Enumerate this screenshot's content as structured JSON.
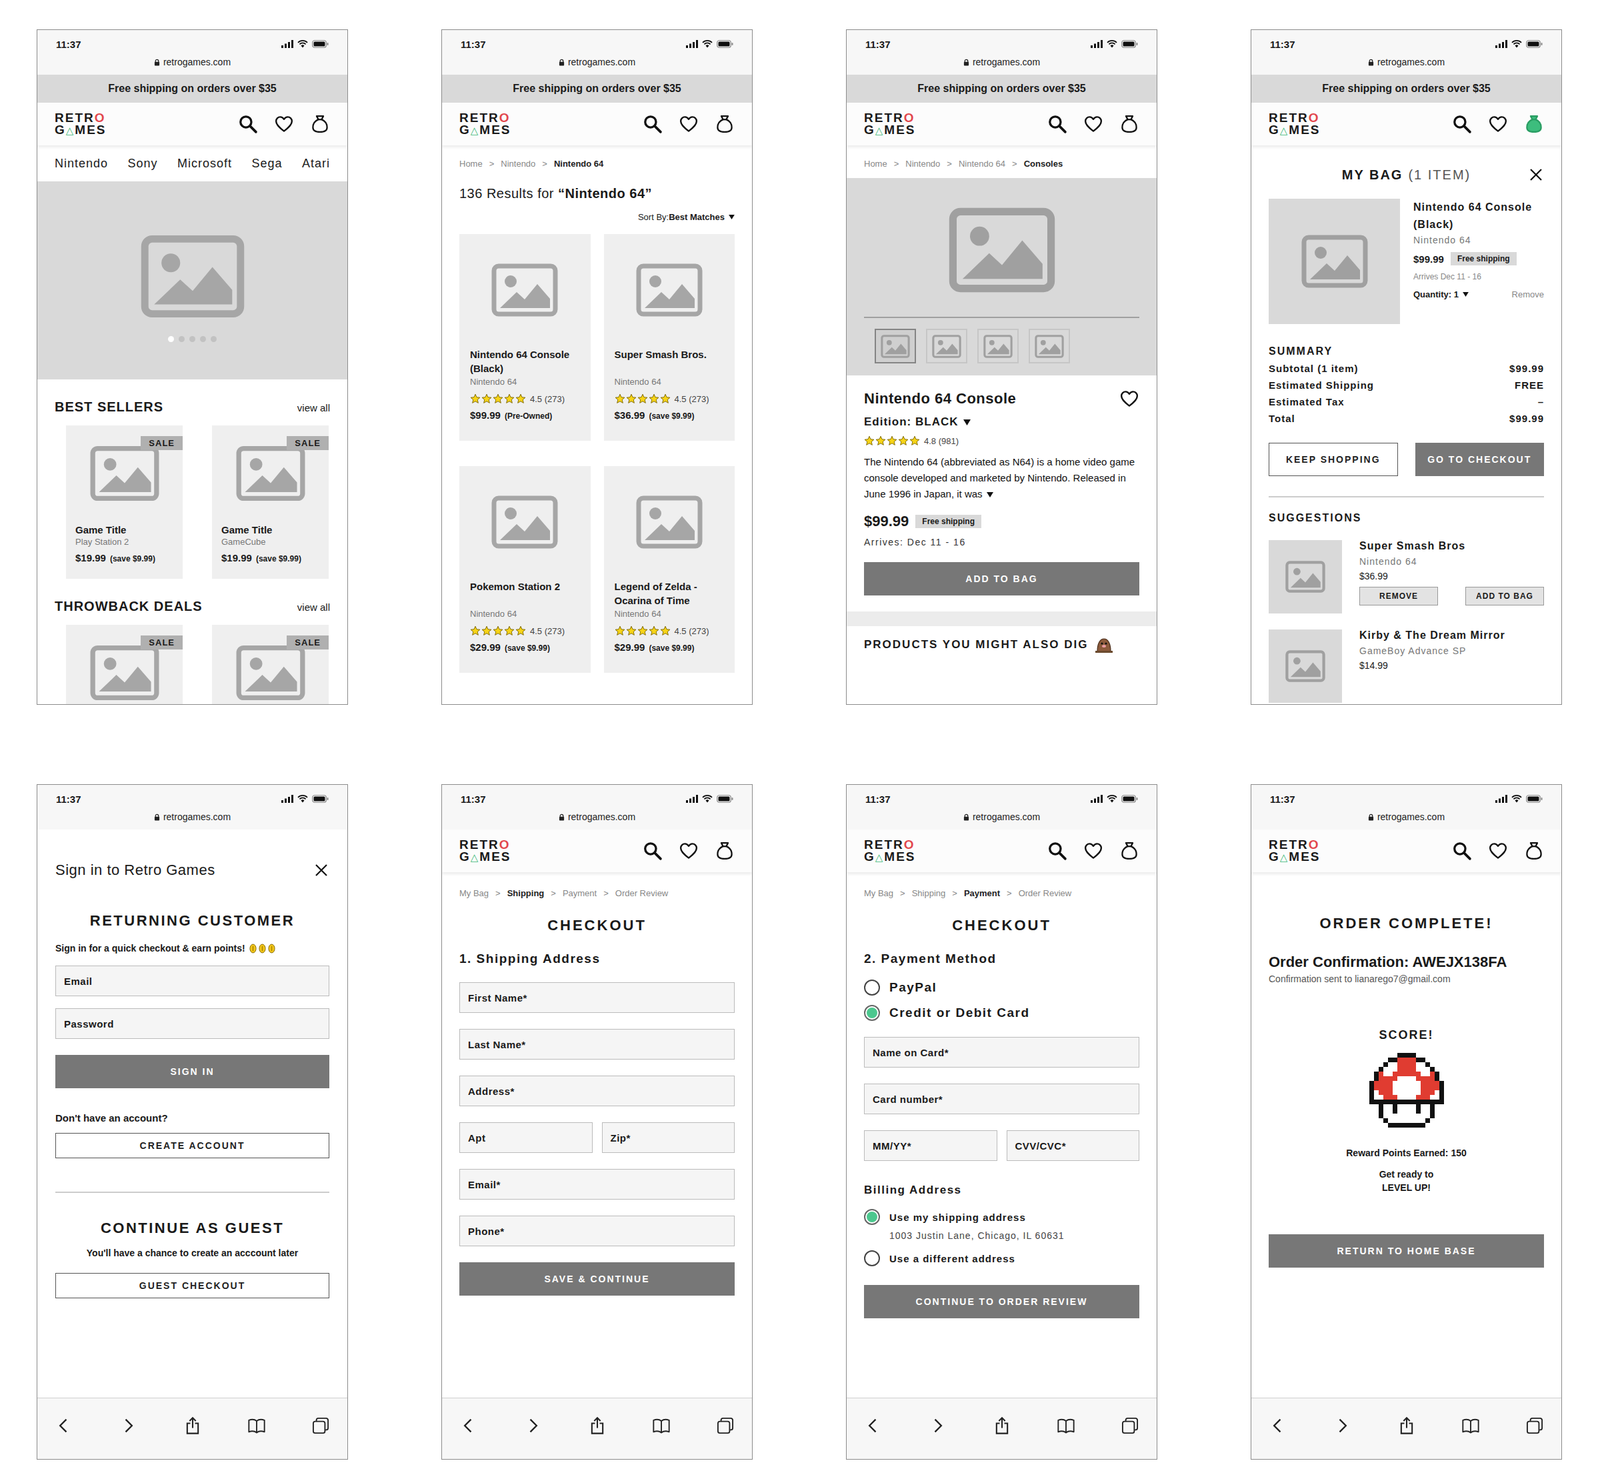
{
  "screens": [
    {
      "kind": "home",
      "status": {
        "time": "11:37",
        "url": "retrogames.com"
      },
      "banner": "Free shipping on orders over $35",
      "header": {
        "logo": {
          "top": "RETR",
          "top_mark": "O",
          "bottom_start": "G",
          "bottom_mark": "△",
          "bottom_end": "MES"
        },
        "bag_active": false
      },
      "nav": [
        "Nintendo",
        "Sony",
        "Microsoft",
        "Sega",
        "Atari"
      ],
      "carousel": [
        {
          "selected": true
        },
        {
          "selected": false
        },
        {
          "selected": false
        },
        {
          "selected": false
        },
        {
          "selected": false
        }
      ],
      "sections": [
        {
          "title": "BEST SELLERS",
          "link": "view all",
          "products": [
            {
              "badge": "SALE",
              "title": "Game Title",
              "platform": "Play Station 2",
              "price": "$19.99",
              "note": "(save $9.99)"
            },
            {
              "badge": "SALE",
              "title": "Game Title",
              "platform": "GameCube",
              "price": "$19.99",
              "note": "(save $9.99)"
            }
          ]
        },
        {
          "title": "THROWBACK DEALS",
          "link": "view all",
          "products": [
            {
              "badge": "SALE"
            },
            {
              "badge": "SALE"
            }
          ]
        }
      ]
    },
    {
      "kind": "results",
      "status": {
        "time": "11:37",
        "url": "retrogames.com"
      },
      "banner": "Free shipping on orders over $35",
      "header": {
        "logo": {
          "top": "RETR",
          "top_mark": "O",
          "bottom_start": "G",
          "bottom_mark": "△",
          "bottom_end": "MES"
        },
        "bag_active": false
      },
      "breadcrumb": [
        {
          "label": "Home",
          "selected": false
        },
        {
          "label": "Nintendo",
          "selected": false
        },
        {
          "label": "Nintendo 64",
          "selected": true
        }
      ],
      "separator": ">",
      "heading": {
        "prefix": "136 Results for ",
        "query": "“Nintendo 64”"
      },
      "sort": {
        "label": "Sort By: ",
        "value": "Best Matches"
      },
      "products": [
        {
          "title": "Nintendo 64 Console (Black)",
          "platform": "Nintendo 64",
          "stars": 5,
          "rating": "4.5 (273)",
          "price": "$99.99",
          "note": "(Pre-Owned)"
        },
        {
          "title": "Super Smash Bros.",
          "platform": "Nintendo 64",
          "stars": 5,
          "rating": "4.5 (273)",
          "price": "$36.99",
          "note": "(save $9.99)"
        },
        {
          "title": "Pokemon Station 2",
          "platform": "Nintendo 64",
          "stars": 5,
          "rating": "4.5 (273)",
          "price": "$29.99",
          "note": "(save $9.99)"
        },
        {
          "title": "Legend of Zelda - Ocarina of Time",
          "platform": "Nintendo 64",
          "stars": 5,
          "rating": "4.5 (273)",
          "price": "$29.99",
          "note": "(save $9.99)"
        }
      ]
    },
    {
      "kind": "product",
      "status": {
        "time": "11:37",
        "url": "retrogames.com"
      },
      "banner": "Free shipping on orders over $35",
      "header": {
        "logo": {
          "top": "RETR",
          "top_mark": "O",
          "bottom_start": "G",
          "bottom_mark": "△",
          "bottom_end": "MES"
        },
        "bag_active": false
      },
      "breadcrumb": [
        {
          "label": "Home",
          "selected": false
        },
        {
          "label": "Nintendo",
          "selected": false
        },
        {
          "label": "Nintendo 64",
          "selected": false
        },
        {
          "label": "Consoles",
          "selected": true
        }
      ],
      "separator": ">",
      "thumbnails": [
        {
          "selected": true
        },
        {
          "selected": false
        },
        {
          "selected": false
        },
        {
          "selected": false
        }
      ],
      "title": "Nintendo 64 Console",
      "edition": {
        "label": "Edition: ",
        "value": "BLACK"
      },
      "stars": 5,
      "rating": "4.8 (981)",
      "description": "The Nintendo 64 (abbreviated as N64) is a home video game console developed and marketed by Nintendo. Released in June 1996 in Japan, it was",
      "price": "$99.99",
      "shipping_badge": "Free shipping",
      "arrival": "Arrives: Dec 11 - 16",
      "button": "ADD TO BAG",
      "related": "PRODUCTS YOU MIGHT ALSO DIG"
    },
    {
      "kind": "bag",
      "status": {
        "time": "11:37",
        "url": "retrogames.com"
      },
      "banner": "Free shipping on orders over $35",
      "header": {
        "logo": {
          "top": "RETR",
          "top_mark": "O",
          "bottom_start": "G",
          "bottom_mark": "△",
          "bottom_end": "MES"
        },
        "bag_active": true
      },
      "title": "MY BAG",
      "count": "(1 ITEM)",
      "item": {
        "title": "Nintendo 64 Console (Black)",
        "platform": "Nintendo 64",
        "price": "$99.99",
        "badge": "Free shipping",
        "arrival": "Arrives Dec 11 - 16",
        "quantity": "Quantity: 1",
        "remove": "Remove"
      },
      "summary": {
        "title": "SUMMARY",
        "rows": [
          {
            "label": "Subtotal (1 item)",
            "value": "$99.99"
          },
          {
            "label": "Estimated Shipping",
            "value": "FREE"
          },
          {
            "label": "Estimated Tax",
            "value": "–"
          },
          {
            "label": "Total",
            "value": "$99.99"
          }
        ]
      },
      "buttons": [
        {
          "label": "KEEP SHOPPING",
          "kind": "outline"
        },
        {
          "label": "GO TO CHECKOUT",
          "kind": "filled"
        }
      ],
      "suggestions": {
        "title": "SUGGESTIONS",
        "items": [
          {
            "title": "Super Smash Bros",
            "platform": "Nintendo 64",
            "price": "$36.99",
            "actions": [
              "REMOVE",
              "ADD TO BAG"
            ]
          },
          {
            "title": "Kirby & The Dream Mirror",
            "platform": "GameBoy Advance SP",
            "price": "$14.99",
            "actions": []
          }
        ]
      }
    },
    {
      "kind": "signin",
      "status": {
        "time": "11:37",
        "url": "retrogames.com"
      },
      "title": "Sign in to Retro Games",
      "returning": {
        "title": "RETURNING CUSTOMER",
        "subtitle": "Sign in for a quick checkout & earn points!",
        "coins": 3,
        "fields": [
          "Email",
          "Password"
        ],
        "button": "SIGN IN"
      },
      "create": {
        "prompt": "Don't have an account?",
        "button": "CREATE ACCOUNT"
      },
      "guest": {
        "title": "CONTINUE AS GUEST",
        "subtitle": "You'll have a chance to create an acccount later",
        "button": "GUEST CHECKOUT"
      }
    },
    {
      "kind": "shipping",
      "status": {
        "time": "11:37",
        "url": "retrogames.com"
      },
      "header": {
        "logo": {
          "top": "RETR",
          "top_mark": "O",
          "bottom_start": "G",
          "bottom_mark": "△",
          "bottom_end": "MES"
        },
        "bag_active": false
      },
      "steps": [
        {
          "label": "My Bag",
          "selected": false
        },
        {
          "label": "Shipping",
          "selected": true
        },
        {
          "label": "Payment",
          "selected": false
        },
        {
          "label": "Order Review",
          "selected": false
        }
      ],
      "separator": ">",
      "title": "CHECKOUT",
      "section": "1. Shipping Address",
      "fields": [
        [
          "First Name*"
        ],
        [
          "Last Name*"
        ],
        [
          "Address*"
        ],
        [
          "Apt",
          "Zip*"
        ],
        [
          "Email*"
        ],
        [
          "Phone*"
        ]
      ],
      "button": "SAVE & CONTINUE"
    },
    {
      "kind": "payment",
      "status": {
        "time": "11:37",
        "url": "retrogames.com"
      },
      "header": {
        "logo": {
          "top": "RETR",
          "top_mark": "O",
          "bottom_start": "G",
          "bottom_mark": "△",
          "bottom_end": "MES"
        },
        "bag_active": false
      },
      "steps": [
        {
          "label": "My Bag",
          "selected": false
        },
        {
          "label": "Shipping",
          "selected": false
        },
        {
          "label": "Payment",
          "selected": true
        },
        {
          "label": "Order Review",
          "selected": false
        }
      ],
      "separator": ">",
      "title": "CHECKOUT",
      "section": "2. Payment Method",
      "methods": [
        {
          "label": "PayPal",
          "selected": false
        },
        {
          "label": "Credit or Debit Card",
          "selected": true
        }
      ],
      "fields": [
        [
          "Name on Card*"
        ],
        [
          "Card number*"
        ],
        [
          "MM/YY*",
          "CVV/CVC*"
        ]
      ],
      "billing": {
        "title": "Billing Address",
        "options": [
          {
            "label": "Use my shipping address",
            "detail": "1003 Justin Lane, Chicago, IL 60631",
            "selected": true
          },
          {
            "label": "Use a different address",
            "selected": false
          }
        ]
      },
      "button": "CONTINUE TO ORDER REVIEW"
    },
    {
      "kind": "complete",
      "status": {
        "time": "11:37",
        "url": "retrogames.com"
      },
      "header": {
        "logo": {
          "top": "RETR",
          "top_mark": "O",
          "bottom_start": "G",
          "bottom_mark": "△",
          "bottom_end": "MES"
        },
        "bag_active": false
      },
      "title": "ORDER COMPLETE!",
      "confirmation": "Order Confirmation: AWEJX138FA",
      "sent": "Confirmation sent to lianarego7@gmail.com",
      "score": "SCORE!",
      "points": "Reward Points Earned: 150",
      "level_up": [
        "Get ready to",
        "LEVEL UP!"
      ],
      "button": "RETURN TO HOME BASE"
    }
  ]
}
